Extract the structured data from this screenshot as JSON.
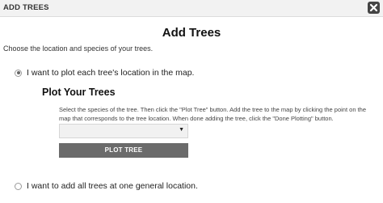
{
  "window": {
    "title": "ADD TREES",
    "close_icon": "close-icon"
  },
  "heading": "Add Trees",
  "intro": "Choose the location and species of your trees.",
  "options": {
    "plot_each": {
      "label": "I want to plot each tree's location in the map.",
      "checked": true
    },
    "general_location": {
      "label": "I want to add all trees at one general location.",
      "checked": false
    }
  },
  "plot_section": {
    "title": "Plot Your Trees",
    "instructions": "Select the species of the tree. Then click the \"Plot Tree\" button. Add the tree to the map by clicking the point on the map that corresponds to the tree location. When done adding the tree, click the \"Done Plotting\" button.",
    "species_select": {
      "value": "",
      "caret_icon": "caret-down-icon"
    },
    "plot_button_label": "PLOT TREE"
  }
}
